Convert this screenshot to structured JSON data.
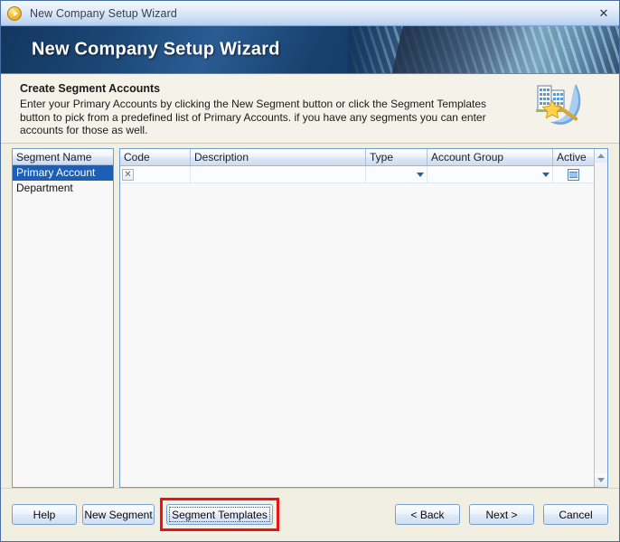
{
  "window": {
    "title": "New Company Setup Wizard",
    "icon": "wizard-orb-icon",
    "close_label": "✕"
  },
  "banner": {
    "title": "New Company Setup Wizard"
  },
  "instructions": {
    "heading": "Create Segment Accounts",
    "body": "Enter your Primary Accounts by clicking the New Segment button or click the Segment Templates button to pick from a predefined list of Primary Accounts. if you have any segments you can enter accounts for those as well.",
    "icon": "building-wizard-wand-icon"
  },
  "segment_panel": {
    "header": "Segment Name",
    "items": [
      {
        "label": "Primary Account",
        "selected": true
      },
      {
        "label": "Department",
        "selected": false
      }
    ]
  },
  "grid": {
    "columns": [
      "Code",
      "Description",
      "Type",
      "Account Group",
      "Active"
    ],
    "rows": [
      {
        "code": "",
        "description": "",
        "type": "",
        "account_group": "",
        "active": true,
        "row_marker_icon": "x-delete-icon"
      }
    ]
  },
  "scrollbar": {
    "up_icon": "scroll-up-arrow-icon",
    "down_icon": "scroll-down-arrow-icon"
  },
  "footer": {
    "help": "Help",
    "new_segment": "New Segment",
    "segment_templates": "Segment Templates",
    "back": "< Back",
    "next": "Next >",
    "cancel": "Cancel"
  },
  "colors": {
    "highlight_box": "#ee1111",
    "selection_blue": "#1d5fb4",
    "banner_blue": "#13365f",
    "panel_border": "#6f9bd1",
    "window_bg": "#f1efe2"
  }
}
